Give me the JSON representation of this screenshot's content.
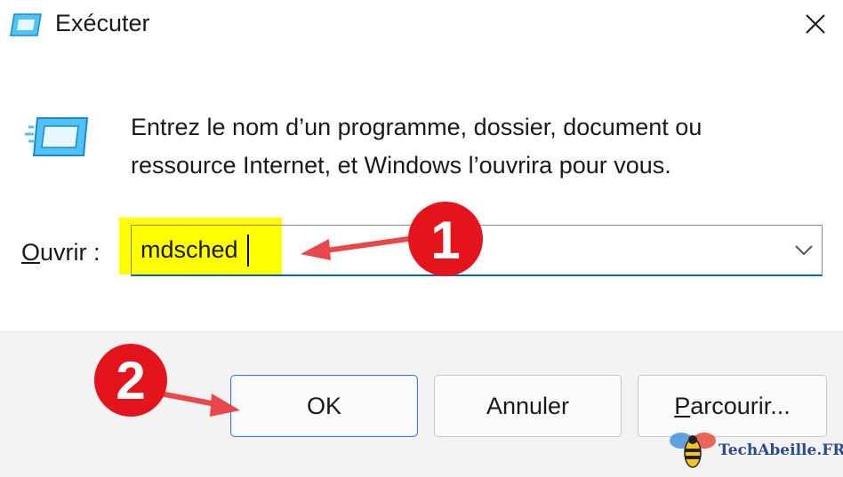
{
  "window": {
    "title": "Exécuter",
    "icon": "run-icon",
    "close_icon": "close-icon"
  },
  "content": {
    "description_line1": "Entrez le nom d’un programme, dossier, document ou",
    "description_line2": "ressource Internet, et Windows l’ouvrira pour vous.",
    "open_label_access_key": "O",
    "open_label_rest": "uvrir :",
    "combo_value": "mdsched",
    "highlight_color": "#ffff00"
  },
  "buttons": {
    "ok_label": "OK",
    "cancel_label": "Annuler",
    "browse_access_key": "P",
    "browse_label_rest": "arcourir..."
  },
  "annotations": {
    "badge_1": "1",
    "badge_2": "2",
    "badge_color": "#e3141b",
    "arrow_color": "#e8474b"
  },
  "watermark": {
    "brand": "TechAbeille",
    "suffix": ".FR"
  }
}
